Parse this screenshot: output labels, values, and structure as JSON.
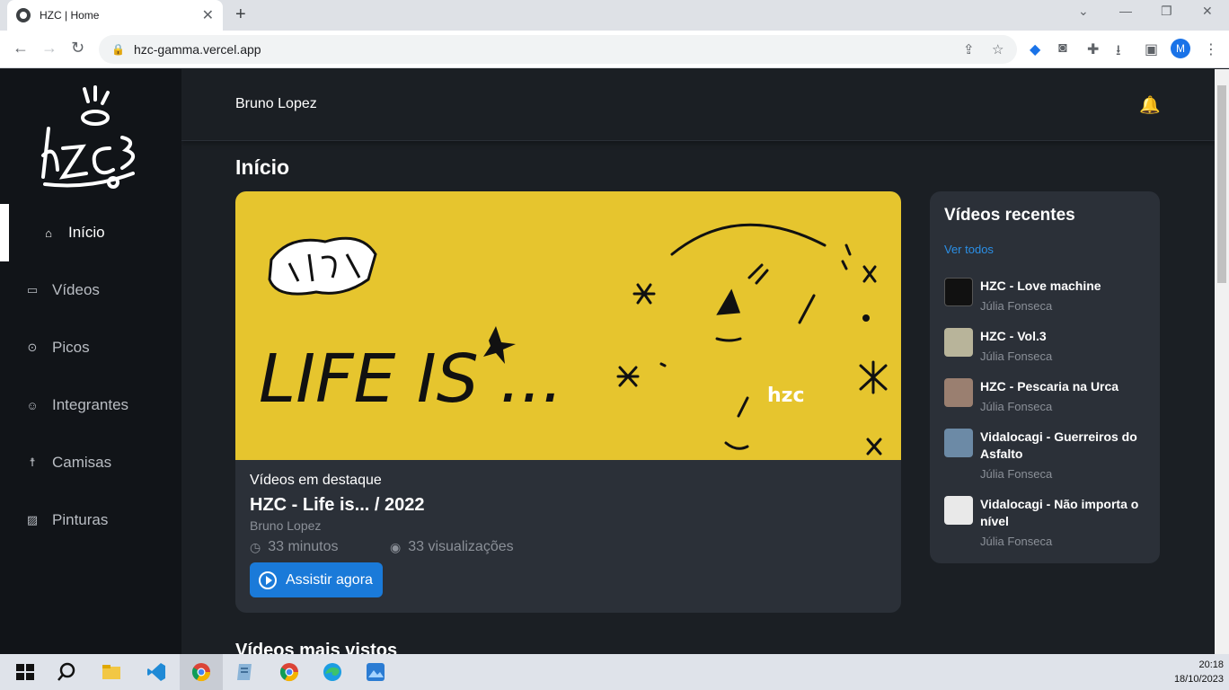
{
  "browser": {
    "tab_title": "HZC | Home",
    "tab_close": "✕",
    "new_tab": "+",
    "url": "hzc-gamma.vercel.app",
    "profile_initial": "M"
  },
  "header": {
    "user_name": "Bruno Lopez"
  },
  "sidebar": {
    "items": [
      {
        "label": "Início",
        "icon": "home-icon",
        "active": true
      },
      {
        "label": "Vídeos",
        "icon": "video-icon"
      },
      {
        "label": "Picos",
        "icon": "map-pin-icon"
      },
      {
        "label": "Integrantes",
        "icon": "users-icon"
      },
      {
        "label": "Camisas",
        "icon": "shirt-icon"
      },
      {
        "label": "Pinturas",
        "icon": "image-icon"
      }
    ]
  },
  "page": {
    "title": "Início",
    "featured": {
      "section_label": "Vídeos em destaque",
      "title": "HZC - Life is... / 2022",
      "author": "Bruno Lopez",
      "duration": "33 minutos",
      "views": "33 visualizações",
      "watch_label": "Assistir agora",
      "thumb_text": "LIFE IS ..."
    },
    "recent": {
      "title": "Vídeos recentes",
      "see_all": "Ver todos",
      "items": [
        {
          "title": "HZC - Love machine",
          "author": "Júlia Fonseca"
        },
        {
          "title": "HZC - Vol.3",
          "author": "Júlia Fonseca"
        },
        {
          "title": "HZC - Pescaria na Urca",
          "author": "Júlia Fonseca"
        },
        {
          "title": "Vidalocagi - Guerreiros do Asfalto",
          "author": "Júlia Fonseca"
        },
        {
          "title": "Vidalocagi - Não importa o nível",
          "author": "Júlia Fonseca"
        }
      ]
    },
    "most_viewed_title": "Vídeos mais vistos"
  },
  "taskbar": {
    "time": "20:18",
    "date": "18/10/2023"
  }
}
